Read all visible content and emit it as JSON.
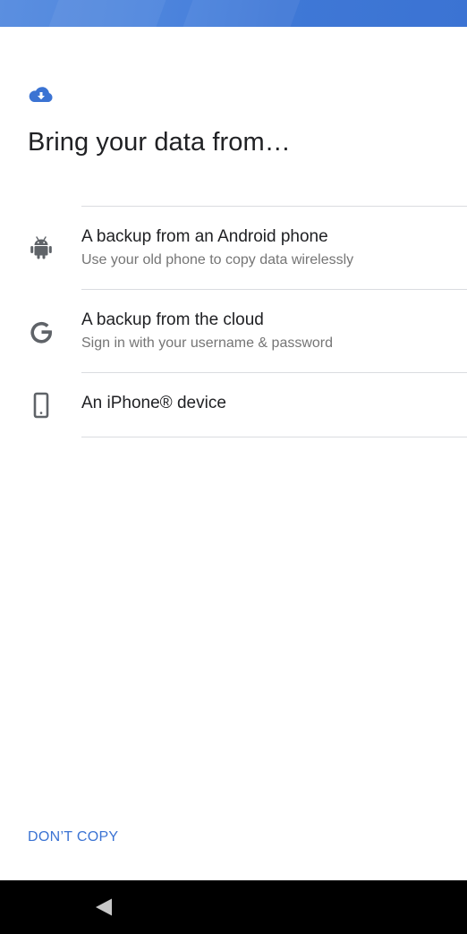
{
  "screen": {
    "title": "Bring your data from…",
    "header_icon": "cloud-download-icon",
    "accent_color": "#3b73d3"
  },
  "options": [
    {
      "icon": "android-icon",
      "primary": "A backup from an Android phone",
      "secondary": "Use your old phone to copy data wirelessly"
    },
    {
      "icon": "google-g-icon",
      "primary": "A backup from the cloud",
      "secondary": "Sign in with your username & password"
    },
    {
      "icon": "smartphone-icon",
      "primary": "An iPhone® device",
      "secondary": ""
    }
  ],
  "footer": {
    "dont_copy_label": "DON’T COPY"
  },
  "navbar": {
    "back_icon": "back-triangle-icon"
  }
}
